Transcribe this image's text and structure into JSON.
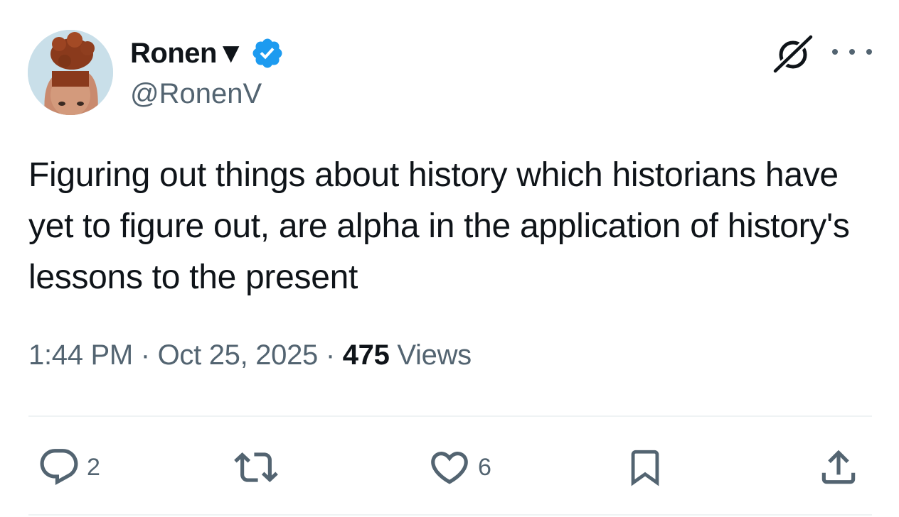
{
  "author": {
    "display_name": "Ronen▼",
    "handle": "@RonenV",
    "verified": true
  },
  "tweet": {
    "text": "Figuring out things about history which historians have yet to figure out, are alpha in the application of history's lessons to the present",
    "time": "1:44 PM",
    "separator": "·",
    "date": "Oct 25, 2025",
    "views_count": "475",
    "views_label": "Views"
  },
  "actions": {
    "reply_count": "2",
    "like_count": "6"
  },
  "colors": {
    "text": "#0f1419",
    "secondary": "#536471",
    "verified_badge": "#1d9bf0",
    "divider": "#eff3f4"
  },
  "icons": [
    "verified-badge-icon",
    "grok-icon",
    "more-icon",
    "reply-icon",
    "retweet-icon",
    "like-icon",
    "bookmark-icon",
    "share-icon"
  ]
}
